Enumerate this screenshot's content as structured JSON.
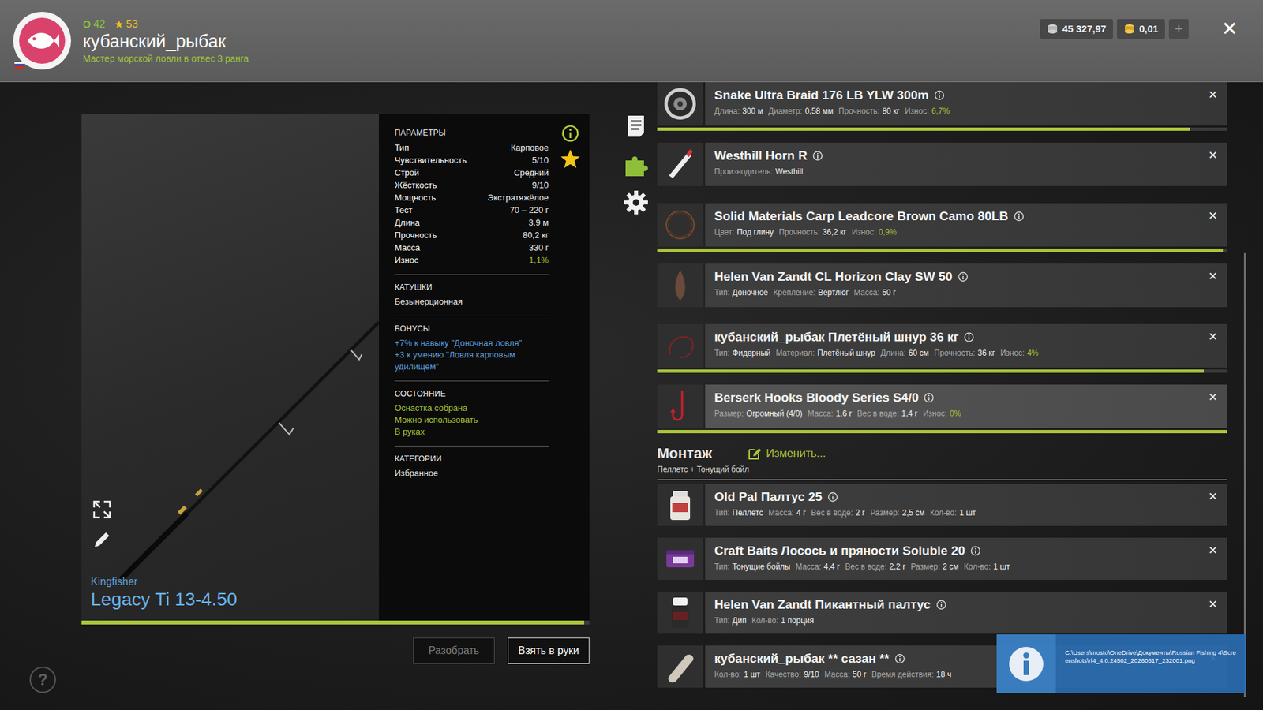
{
  "header": {
    "level_points": "42",
    "star_points": "53",
    "username": "кубанский_рыбак",
    "title": "Мастер морской ловли в отвес 3 ранга",
    "silver": "45 327,97",
    "gold": "0,01",
    "add": "+",
    "close": "✕"
  },
  "rod": {
    "brand": "Kingfisher",
    "name": "Legacy Ti 13-4.50",
    "favorite": true,
    "wear_level": 0.989,
    "sections": [
      {
        "title": "ПАРАМЕТРЫ",
        "kind": "params",
        "rows": [
          {
            "label": "Тип",
            "value": "Карповое",
            "highlight": false
          },
          {
            "label": "Чувствительность",
            "value": "5/10",
            "highlight": false
          },
          {
            "label": "Строй",
            "value": "Средний",
            "highlight": false
          },
          {
            "label": "Жёсткость",
            "value": "9/10",
            "highlight": false
          },
          {
            "label": "Мощность",
            "value": "Экстратяжёлое",
            "highlight": false
          },
          {
            "label": "Тест",
            "value": "70 – 220 г",
            "highlight": false
          },
          {
            "label": "Длина",
            "value": "3,9 м",
            "highlight": false
          },
          {
            "label": "Прочность",
            "value": "80,2 кг",
            "highlight": false
          },
          {
            "label": "Масса",
            "value": "330 г",
            "highlight": false
          },
          {
            "label": "Износ",
            "value": "1,1%",
            "highlight": true
          }
        ]
      },
      {
        "title": "КАТУШКИ",
        "kind": "list",
        "color": "#e6e6e6",
        "lines": [
          "Безынерционная"
        ]
      },
      {
        "title": "БОНУСЫ",
        "kind": "list",
        "color": "#5d9bd8",
        "lines": [
          "+7% к навыку \"Доночная ловля\"",
          "+3 к умению \"Ловля карповым удилищем\""
        ]
      },
      {
        "title": "СОСТОЯНИЕ",
        "kind": "list",
        "color": "#a8c43a",
        "lines": [
          "Оснастка собрана",
          "Можно использовать",
          "В руках"
        ]
      },
      {
        "title": "КАТЕГОРИИ",
        "kind": "list",
        "color": "#e6e6e6",
        "lines": [
          "Избранное"
        ]
      }
    ]
  },
  "side_tabs": [
    {
      "kind": "info",
      "selected": false
    },
    {
      "kind": "parts",
      "selected": true
    },
    {
      "kind": "settings",
      "selected": false
    }
  ],
  "actions": [
    {
      "label": "Разобрать",
      "disabled": true
    },
    {
      "label": "Взять в руки",
      "disabled": false
    }
  ],
  "tackle": {
    "remove": "✕",
    "items": [
      {
        "kind": "braid",
        "name": "Snake Ultra Braid 176 LB YLW 300m",
        "selected": false,
        "level": 0.935,
        "props": [
          {
            "label": "Длина:",
            "value": "300 м",
            "highlight": false
          },
          {
            "label": "Диаметр:",
            "value": "0,58 мм",
            "highlight": false
          },
          {
            "label": "Прочность:",
            "value": "80 кг",
            "highlight": false
          },
          {
            "label": "Износ:",
            "value": "6,7%",
            "highlight": true
          }
        ]
      },
      {
        "kind": "float",
        "name": "Westhill Horn R",
        "selected": false,
        "props": [
          {
            "label": "Производитель:",
            "value": "Westhill",
            "highlight": false
          }
        ]
      },
      {
        "kind": "leadcore",
        "name": "Solid Materials Carp Leadcore Brown Camo 80LB",
        "selected": false,
        "level": 0.993,
        "props": [
          {
            "label": "Цвет:",
            "value": "Под глину",
            "highlight": false
          },
          {
            "label": "Прочность:",
            "value": "36,2 кг",
            "highlight": false
          },
          {
            "label": "Износ:",
            "value": "0,9%",
            "highlight": true
          }
        ]
      },
      {
        "kind": "sinker",
        "name": "Helen Van Zandt CL Horizon Clay SW 50",
        "selected": false,
        "props": [
          {
            "label": "Тип:",
            "value": "Доночное",
            "highlight": false
          },
          {
            "label": "Крепление:",
            "value": "Вертлюг",
            "highlight": false
          },
          {
            "label": "Масса:",
            "value": "50 г",
            "highlight": false
          }
        ]
      },
      {
        "kind": "leader",
        "name": "кубанский_рыбак Плетёный шнур 36 кг",
        "selected": false,
        "level": 0.96,
        "props": [
          {
            "label": "Тип:",
            "value": "Фидерный",
            "highlight": false
          },
          {
            "label": "Материал:",
            "value": "Плетёный шнур",
            "highlight": false
          },
          {
            "label": "Длина:",
            "value": "60 см",
            "highlight": false
          },
          {
            "label": "Прочность:",
            "value": "36 кг",
            "highlight": false
          },
          {
            "label": "Износ:",
            "value": "4%",
            "highlight": true
          }
        ]
      },
      {
        "kind": "hook",
        "name": "Berserk Hooks Bloody Series S4/0",
        "selected": true,
        "level": 1.0,
        "props": [
          {
            "label": "Размер:",
            "value": "Огромный (4/0)",
            "highlight": false
          },
          {
            "label": "Масса:",
            "value": "1,6 г",
            "highlight": false
          },
          {
            "label": "Вес в воде:",
            "value": "1,4 г",
            "highlight": false
          },
          {
            "label": "Износ:",
            "value": "0%",
            "highlight": true
          }
        ]
      }
    ]
  },
  "montage": {
    "title": "Монтаж",
    "edit": "Изменить...",
    "subtitle": "Пеллетс + Тонущий бойл",
    "items": [
      {
        "kind": "pellet",
        "name": "Old Pal Палтус 25",
        "selected": false,
        "props": [
          {
            "label": "Тип:",
            "value": "Пеллетс",
            "highlight": false
          },
          {
            "label": "Масса:",
            "value": "4 г",
            "highlight": false
          },
          {
            "label": "Вес в воде:",
            "value": "2 г",
            "highlight": false
          },
          {
            "label": "Размер:",
            "value": "2,5 см",
            "highlight": false
          },
          {
            "label": "Кол-во:",
            "value": "1 шт",
            "highlight": false
          }
        ]
      },
      {
        "kind": "boilie",
        "name": "Craft Baits Лосось и пряности Soluble 20",
        "selected": false,
        "props": [
          {
            "label": "Тип:",
            "value": "Тонущие бойлы",
            "highlight": false
          },
          {
            "label": "Масса:",
            "value": "4,4 г",
            "highlight": false
          },
          {
            "label": "Вес в воде:",
            "value": "2,2 г",
            "highlight": false
          },
          {
            "label": "Размер:",
            "value": "2 см",
            "highlight": false
          },
          {
            "label": "Кол-во:",
            "value": "1 шт",
            "highlight": false
          }
        ]
      },
      {
        "kind": "dip",
        "name": "Helen Van Zandt Пикантный палтус",
        "selected": false,
        "props": [
          {
            "label": "Тип:",
            "value": "Дип",
            "highlight": false
          },
          {
            "label": "Кол-во:",
            "value": "1 порция",
            "highlight": false
          }
        ]
      },
      {
        "kind": "groundbait",
        "name": "кубанский_рыбак ** сазан **",
        "selected": false,
        "props": [
          {
            "label": "Кол-во:",
            "value": "1 шт",
            "highlight": false
          },
          {
            "label": "Качество:",
            "value": "9/10",
            "highlight": false
          },
          {
            "label": "Масса:",
            "value": "50 г",
            "highlight": false
          },
          {
            "label": "Время действия:",
            "value": "18 ч",
            "highlight": false
          }
        ]
      }
    ]
  },
  "help": "?",
  "notification": {
    "text": "C:\\Users\\mosto\\OneDrive\\Документы\\Russian Fishing 4\\Screenshots\\rf4_4.0.24502_20260517_232001.png"
  }
}
